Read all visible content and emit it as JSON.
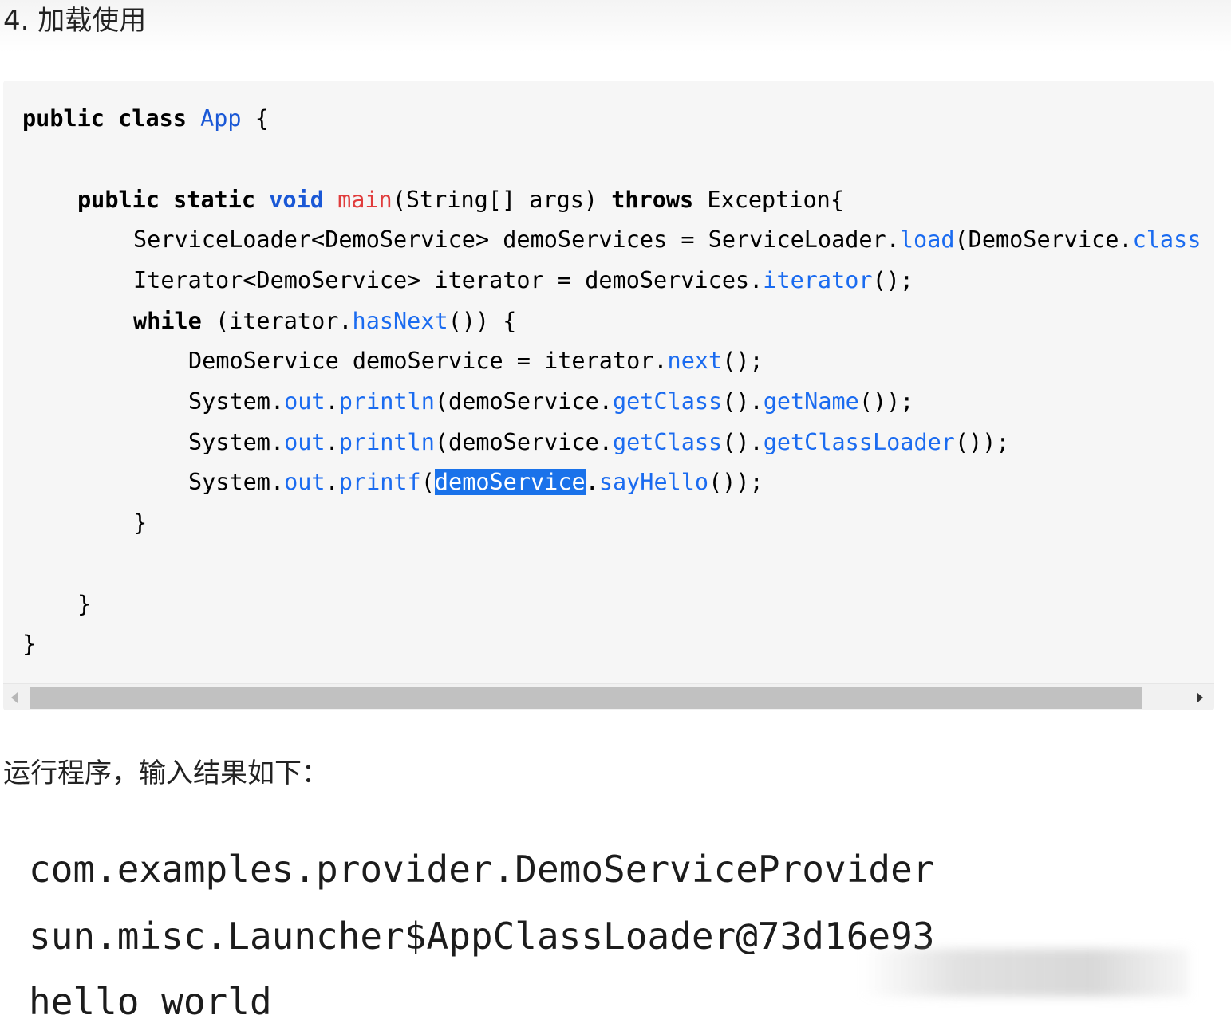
{
  "heading": "4. 加载使用",
  "code": {
    "l1": {
      "kw1": "public",
      "kw2": "class",
      "cls": "App",
      "brace": "{"
    },
    "l2": {
      "kw1": "public",
      "kw2": "static",
      "kw3": "void",
      "fn": "main",
      "params": "(String[] args)",
      "kw4": "throws",
      "exc": "Exception{"
    },
    "l3": {
      "a": "ServiceLoader<DemoService> demoServices = ServiceLoader.",
      "m": "load",
      "b": "(DemoService.",
      "c": "class"
    },
    "l4": {
      "a": "Iterator<DemoService> iterator = demoServices.",
      "m": "iterator",
      "b": "();"
    },
    "l5": {
      "kw": "while",
      "a": " (iterator.",
      "m": "hasNext",
      "b": "()) {"
    },
    "l6": {
      "a": "DemoService demoService = iterator.",
      "m": "next",
      "b": "();"
    },
    "l7": {
      "a": "System.",
      "f": "out",
      "d": ".",
      "m1": "println",
      "b": "(demoService.",
      "m2": "getClass",
      "c": "().",
      "m3": "getName",
      "e": "());"
    },
    "l8": {
      "a": "System.",
      "f": "out",
      "d": ".",
      "m1": "println",
      "b": "(demoService.",
      "m2": "getClass",
      "c": "().",
      "m3": "getClassLoader",
      "e": "());"
    },
    "l9": {
      "a": "System.",
      "f": "out",
      "d": ".",
      "m1": "printf",
      "p": "(",
      "sel": "demoService",
      "d2": ".",
      "m2": "sayHello",
      "e": "());"
    },
    "close_while": "}",
    "close_main": "}",
    "close_class": "}"
  },
  "result_intro": "运行程序，输入结果如下：",
  "output_lines": [
    "com.examples.provider.DemoServiceProvider",
    "sun.misc.Launcher$AppClassLoader@73d16e93",
    "hello world"
  ]
}
